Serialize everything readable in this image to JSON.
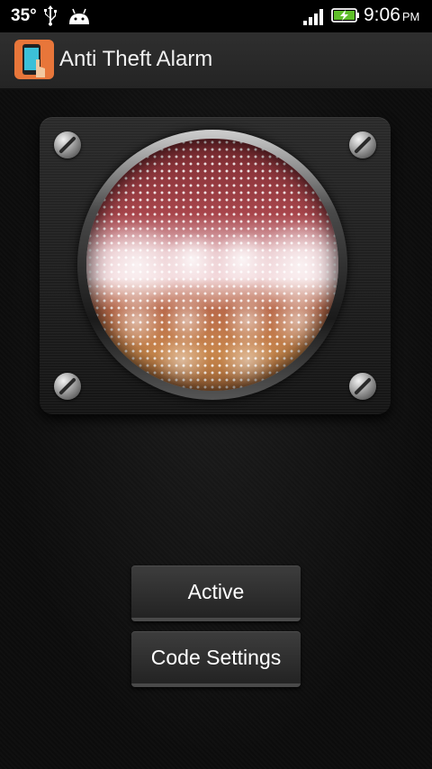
{
  "status_bar": {
    "temperature": "35°",
    "time": "9:06",
    "ampm": "PM",
    "icons": [
      "usb-icon",
      "android-icon",
      "signal-icon",
      "battery-charging-icon"
    ]
  },
  "action_bar": {
    "title": "Anti Theft Alarm",
    "icon": "phone-hand-icon"
  },
  "main": {
    "buttons": [
      {
        "label": "Active"
      },
      {
        "label": "Code Settings"
      }
    ]
  },
  "colors": {
    "background": "#0f0f0f",
    "action_bar": "#2b2b2b",
    "button": "#2e2e2e",
    "grille_red": "#a8464c",
    "grille_pink": "#f3d9dc",
    "grille_amber": "#c8874c"
  }
}
